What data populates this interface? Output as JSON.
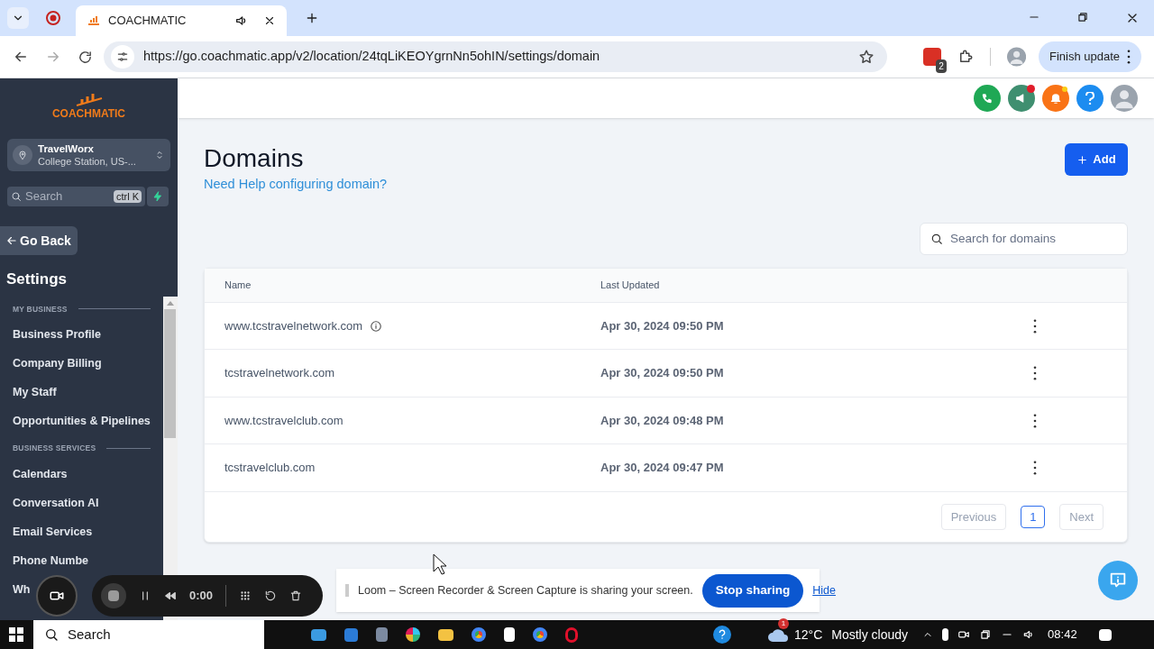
{
  "browser": {
    "tab_title": "COACHMATIC",
    "url": "https://go.coachmatic.app/v2/location/24tqLiKEOYgrnNn5ohIN/settings/domain",
    "extension_badge": "2",
    "finish_update": "Finish update"
  },
  "sidebar": {
    "brand": "COACHMATIC",
    "location_name": "TravelWorx",
    "location_sub": "College Station, US-...",
    "search_placeholder": "Search",
    "shortcut": "ctrl K",
    "go_back": "Go Back",
    "title": "Settings",
    "sections": [
      {
        "heading": "MY BUSINESS",
        "items": [
          "Business Profile",
          "Company Billing",
          "My Staff",
          "Opportunities & Pipelines"
        ]
      },
      {
        "heading": "BUSINESS SERVICES",
        "items": [
          "Calendars",
          "Conversation AI",
          "Email Services",
          "Phone Numbe",
          "Wh"
        ]
      }
    ]
  },
  "main": {
    "title": "Domains",
    "help_link": "Need Help configuring domain?",
    "add_button": "Add",
    "search_placeholder": "Search for domains",
    "columns": [
      "Name",
      "Last Updated"
    ],
    "rows": [
      {
        "name": "www.tcstravelnetwork.com",
        "info": true,
        "updated": "Apr 30, 2024 09:50 PM"
      },
      {
        "name": "tcstravelnetwork.com",
        "info": false,
        "updated": "Apr 30, 2024 09:50 PM"
      },
      {
        "name": "www.tcstravelclub.com",
        "info": false,
        "updated": "Apr 30, 2024 09:48 PM"
      },
      {
        "name": "tcstravelclub.com",
        "info": false,
        "updated": "Apr 30, 2024 09:47 PM"
      }
    ],
    "pagination": {
      "previous": "Previous",
      "pages": [
        {
          "label": "1",
          "selected": true
        }
      ],
      "next": "Next"
    }
  },
  "loom": {
    "timer": "0:00",
    "message": "Loom – Screen Recorder & Screen Capture is sharing your screen.",
    "stop": "Stop sharing",
    "hide": "Hide"
  },
  "taskbar": {
    "search": "Search",
    "weather_badge": "1",
    "temperature": "12°C",
    "condition": "Mostly cloudy",
    "time": "08:42"
  }
}
